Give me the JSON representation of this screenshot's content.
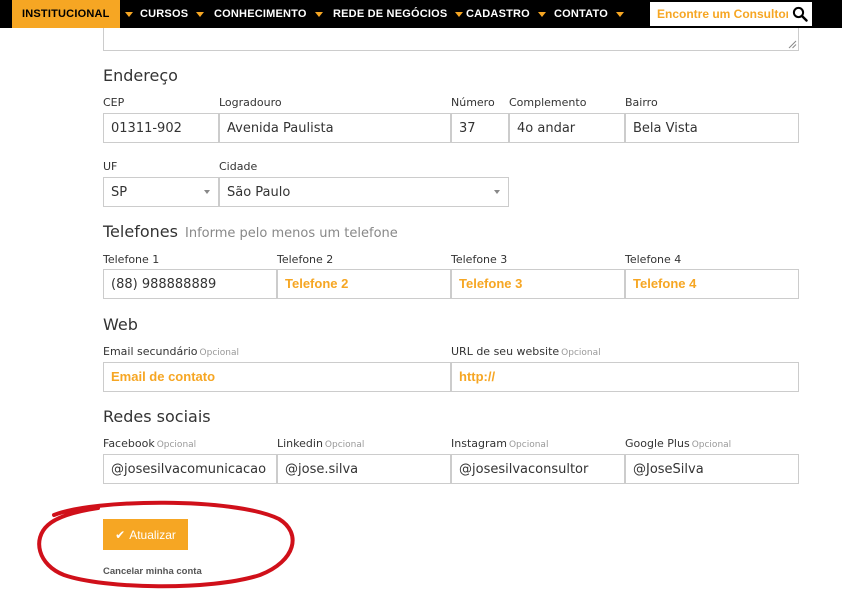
{
  "nav": {
    "items": [
      {
        "label": "INSTITUCIONAL"
      },
      {
        "label": "CURSOS"
      },
      {
        "label": "CONHECIMENTO"
      },
      {
        "label": "REDE DE NEGÓCIOS"
      },
      {
        "label": "CADASTRO"
      },
      {
        "label": "CONTATO"
      }
    ],
    "search_placeholder": "Encontre um Consultor..."
  },
  "address": {
    "title": "Endereço",
    "cep": {
      "label": "CEP",
      "value": "01311-902"
    },
    "logradouro": {
      "label": "Logradouro",
      "value": "Avenida Paulista"
    },
    "numero": {
      "label": "Número",
      "value": "37"
    },
    "complemento": {
      "label": "Complemento",
      "value": "4o andar"
    },
    "bairro": {
      "label": "Bairro",
      "value": "Bela Vista"
    },
    "uf": {
      "label": "UF",
      "value": "SP"
    },
    "cidade": {
      "label": "Cidade",
      "value": "São Paulo"
    }
  },
  "phones": {
    "title": "Telefones",
    "hint": "Informe pelo menos um telefone",
    "fields": [
      {
        "label": "Telefone 1",
        "value": "(88) 988888889",
        "placeholder": ""
      },
      {
        "label": "Telefone 2",
        "value": "",
        "placeholder": "Telefone 2"
      },
      {
        "label": "Telefone 3",
        "value": "",
        "placeholder": "Telefone 3"
      },
      {
        "label": "Telefone 4",
        "value": "",
        "placeholder": "Telefone 4"
      }
    ]
  },
  "web": {
    "title": "Web",
    "email": {
      "label": "Email secundário",
      "optional": "Opcional",
      "placeholder": "Email de contato"
    },
    "url": {
      "label": "URL de seu website",
      "optional": "Opcional",
      "placeholder": "http://"
    }
  },
  "social": {
    "title": "Redes sociais",
    "fields": [
      {
        "label": "Facebook",
        "optional": "Opcional",
        "value": "@josesilvacomunicacao"
      },
      {
        "label": "Linkedin",
        "optional": "Opcional",
        "value": "@jose.silva"
      },
      {
        "label": "Instagram",
        "optional": "Opcional",
        "value": "@josesilvaconsultor"
      },
      {
        "label": "Google Plus",
        "optional": "Opcional",
        "value": "@JoseSilva"
      }
    ]
  },
  "actions": {
    "update_label": "Atualizar",
    "cancel_label": "Cancelar minha conta"
  },
  "colors": {
    "accent": "#f6a623",
    "annotation": "#d0101a",
    "navbar": "#000000"
  }
}
